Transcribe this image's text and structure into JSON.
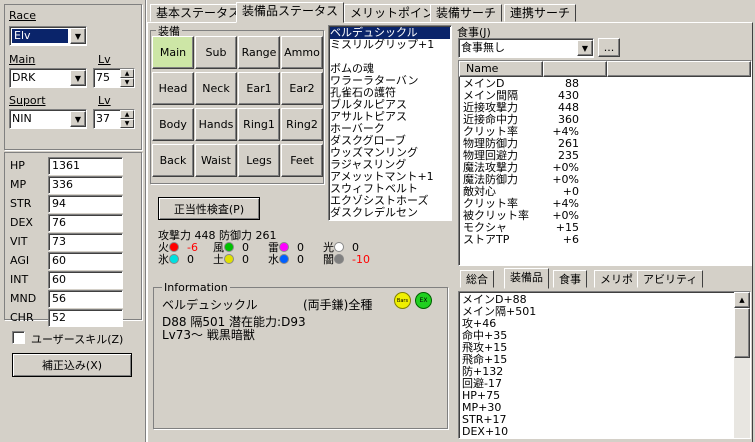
{
  "left": {
    "race_label": "Race",
    "race_value": "Elv",
    "main_label": "Main",
    "main_value": "DRK",
    "main_lv_label": "Lv",
    "main_lv": "75",
    "support_label": "Suport",
    "support_value": "NIN",
    "support_lv_label": "Lv",
    "support_lv": "37",
    "stats": [
      {
        "label": "HP",
        "value": "1361"
      },
      {
        "label": "MP",
        "value": "336"
      },
      {
        "label": "STR",
        "value": "94"
      },
      {
        "label": "DEX",
        "value": "76"
      },
      {
        "label": "VIT",
        "value": "73"
      },
      {
        "label": "AGI",
        "value": "60"
      },
      {
        "label": "INT",
        "value": "60"
      },
      {
        "label": "MND",
        "value": "56"
      },
      {
        "label": "CHR",
        "value": "52"
      }
    ],
    "user_skill_label": "ユーザースキル(Z)",
    "correction_button": "補正込み(X)"
  },
  "tabs": [
    "基本ステータス",
    "装備品ステータス",
    "メリットポイント",
    "装備サーチ",
    "連携サーチ"
  ],
  "equip": {
    "group_label": "装備",
    "slots": [
      "Main",
      "Sub",
      "Range",
      "Ammo",
      "Head",
      "Neck",
      "Ear1",
      "Ear2",
      "Body",
      "Hands",
      "Ring1",
      "Ring2",
      "Back",
      "Waist",
      "Legs",
      "Feet"
    ],
    "check_button": "正当性検査(P)",
    "attack_line": "攻撃力 448 防御力 261",
    "elements": [
      {
        "name": "火",
        "value": "-6",
        "color": "#ff0000",
        "negative": true
      },
      {
        "name": "風",
        "value": "0",
        "color": "#00c000",
        "negative": false
      },
      {
        "name": "雷",
        "value": "0",
        "color": "#ff00ff",
        "negative": false
      },
      {
        "name": "光",
        "value": "0",
        "color": "#ffffff",
        "negative": false
      },
      {
        "name": "氷",
        "value": "0",
        "color": "#00e0e0",
        "negative": false
      },
      {
        "name": "土",
        "value": "0",
        "color": "#e0e000",
        "negative": false
      },
      {
        "name": "水",
        "value": "0",
        "color": "#0060ff",
        "negative": false
      },
      {
        "name": "闇",
        "value": "-10",
        "color": "#808080",
        "negative": true
      }
    ],
    "info_label": "Information",
    "info_name": "ベルデュシックル",
    "info_type": "(両手鎌)全種",
    "info_badges": [
      "Bars",
      "EX"
    ],
    "info_line1": "D88 隔501 潜在能力:D93",
    "info_line2": "Lv73〜 戦黒暗獣"
  },
  "items": [
    "ベルデュシックル",
    "ミスリルグリップ+1",
    "",
    "ボムの魂",
    "ワラーラターバン",
    "孔雀石の護符",
    "ブルタルピアス",
    "アサルトピアス",
    "ホーバーク",
    "ダスクグローブ",
    "ウッズマンリング",
    "ラジャスリング",
    "アメッットマント+1",
    "スウィフトベルト",
    "エクゾシストホーズ",
    "ダスクレデルセン"
  ],
  "food": {
    "label": "食事(J)",
    "value": "食事無し",
    "button": "..."
  },
  "status": {
    "header": "Name",
    "rows": [
      {
        "name": "メインD",
        "value": "88"
      },
      {
        "name": "メイン間隔",
        "value": "430"
      },
      {
        "name": "近接攻撃力",
        "value": "448"
      },
      {
        "name": "近接命中力",
        "value": "360"
      },
      {
        "name": "クリット率",
        "value": "+4%"
      },
      {
        "name": "物理防御力",
        "value": "261"
      },
      {
        "name": "物理回避力",
        "value": "235"
      },
      {
        "name": "魔法攻撃力",
        "value": "+0%"
      },
      {
        "name": "魔法防御力",
        "value": "+0%"
      },
      {
        "name": "敵対心",
        "value": "+0"
      },
      {
        "name": "クリット率",
        "value": "+4%"
      },
      {
        "name": "被クリット率",
        "value": "+0%"
      },
      {
        "name": "モクシャ",
        "value": "+15"
      },
      {
        "name": "ストアTP",
        "value": "+6"
      }
    ]
  },
  "sub_tabs": [
    "総合",
    "装備品",
    "食事",
    "メリポ",
    "アビリティ"
  ],
  "effects": [
    "メインD+88",
    "メイン隔+501",
    "攻+46",
    "命中+35",
    "飛攻+15",
    "飛命+15",
    "防+132",
    "回避-17",
    "HP+75",
    "MP+30",
    "STR+17",
    "DEX+10"
  ]
}
